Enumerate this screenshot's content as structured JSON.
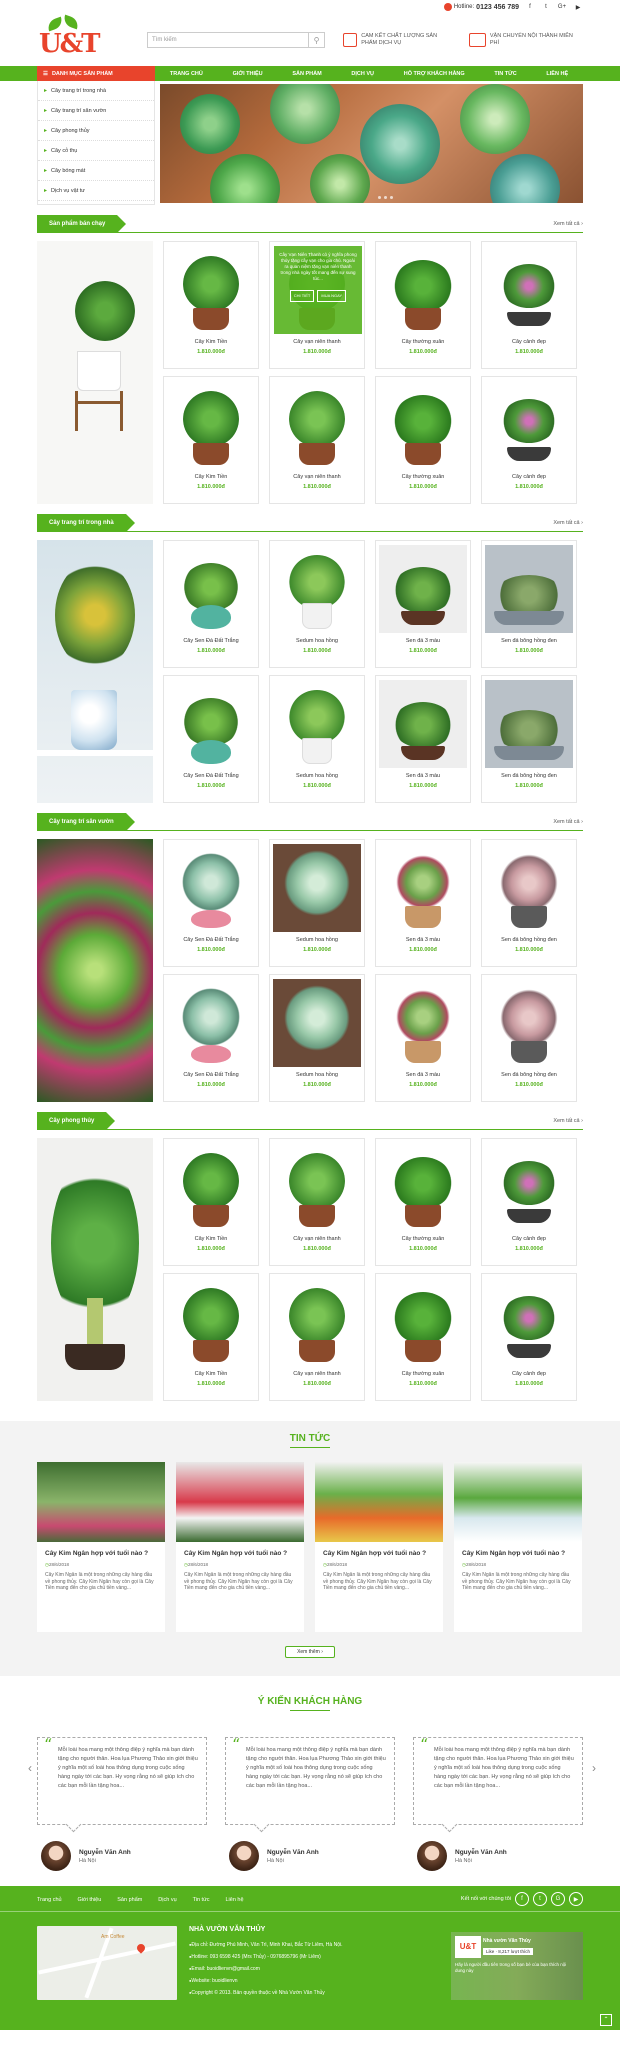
{
  "topbar": {
    "hotline_label": "Hotline:",
    "hotline_number": "0123 456 789",
    "social": [
      "f",
      "t",
      "G+",
      "▶"
    ]
  },
  "header": {
    "logo_text": "U&T",
    "search_placeholder": "Tìm kiếm",
    "promo1": "CAM KẾT CHẤT LƯỢNG SẢN PHẨM DỊCH VỤ",
    "promo2": "VẬN CHUYỂN NỘI THÀNH MIỄN PHÍ"
  },
  "nav": {
    "category_title": "DANH MỤC SẢN PHẨM",
    "items": [
      "TRANG CHỦ",
      "GIỚI THIỆU",
      "SẢN PHẨM",
      "DỊCH VỤ",
      "HỖ TRỢ KHÁCH HÀNG",
      "TIN TỨC",
      "LIÊN HỆ"
    ]
  },
  "sidebar": {
    "items": [
      "Cây trang trí trong nhà",
      "Cây trang trí sân vườn",
      "Cây phong thủy",
      "Cây cỏ thụ",
      "Cây bóng mát",
      "Dịch vụ vật tư"
    ]
  },
  "sections": [
    {
      "title": "Sản phẩm bán chạy",
      "more": "Xem tất cả",
      "products": [
        {
          "name": "Cây Kim Tiền",
          "price": "1.810.000đ"
        },
        {
          "name": "Cây vạn niên thanh",
          "price": "1.810.000đ"
        },
        {
          "name": "Cây thường xuân",
          "price": "1.810.000đ"
        },
        {
          "name": "Cây cảnh đẹp",
          "price": "1.810.000đ"
        },
        {
          "name": "Cây Kim Tiền",
          "price": "1.810.000đ"
        },
        {
          "name": "Cây vạn niên thanh",
          "price": "1.810.000đ"
        },
        {
          "name": "Cây thường xuân",
          "price": "1.810.000đ"
        },
        {
          "name": "Cây cảnh đẹp",
          "price": "1.810.000đ"
        }
      ],
      "hover_text": "Cây Vạn Niên Thanh cỏ ý nghĩa phong thủy tặng cây vạn cho gia chủ. Ngoài ra quan niệm tặng vạn niên thanh trong nhà ngày tốt mang đến sự sung túc...",
      "hover_btn1": "CHI TIẾT",
      "hover_btn2": "MUA NGAY"
    },
    {
      "title": "Cây trang trí trong nhà",
      "more": "Xem tất cả",
      "products": [
        {
          "name": "Cây Sen Đá Đất Trắng",
          "price": "1.810.000đ"
        },
        {
          "name": "Sedum hoa hồng",
          "price": "1.810.000đ"
        },
        {
          "name": "Sen đá 3 màu",
          "price": "1.810.000đ"
        },
        {
          "name": "Sen đá bông hồng đen",
          "price": "1.810.000đ"
        },
        {
          "name": "Cây Sen Đá Đất Trắng",
          "price": "1.810.000đ"
        },
        {
          "name": "Sedum hoa hồng",
          "price": "1.810.000đ"
        },
        {
          "name": "Sen đá 3 màu",
          "price": "1.810.000đ"
        },
        {
          "name": "Sen đá bông hồng đen",
          "price": "1.810.000đ"
        }
      ]
    },
    {
      "title": "Cây trang trí sân vườn",
      "more": "Xem tất cả",
      "products": [
        {
          "name": "Cây Sen Đá Đất Trắng",
          "price": "1.810.000đ"
        },
        {
          "name": "Sedum hoa hồng",
          "price": "1.810.000đ"
        },
        {
          "name": "Sen đá 3 màu",
          "price": "1.810.000đ"
        },
        {
          "name": "Sen đá bông hồng đen",
          "price": "1.810.000đ"
        },
        {
          "name": "Cây Sen Đá Đất Trắng",
          "price": "1.810.000đ"
        },
        {
          "name": "Sedum hoa hồng",
          "price": "1.810.000đ"
        },
        {
          "name": "Sen đá 3 màu",
          "price": "1.810.000đ"
        },
        {
          "name": "Sen đá bông hồng đen",
          "price": "1.810.000đ"
        }
      ]
    },
    {
      "title": "Cây phong thủy",
      "more": "Xem tất cả",
      "products": [
        {
          "name": "Cây Kim Tiền",
          "price": "1.810.000đ"
        },
        {
          "name": "Cây vạn niên thanh",
          "price": "1.810.000đ"
        },
        {
          "name": "Cây thường xuân",
          "price": "1.810.000đ"
        },
        {
          "name": "Cây cảnh đẹp",
          "price": "1.810.000đ"
        },
        {
          "name": "Cây Kim Tiền",
          "price": "1.810.000đ"
        },
        {
          "name": "Cây vạn niên thanh",
          "price": "1.810.000đ"
        },
        {
          "name": "Cây thường xuân",
          "price": "1.810.000đ"
        },
        {
          "name": "Cây cảnh đẹp",
          "price": "1.810.000đ"
        }
      ]
    }
  ],
  "news": {
    "title": "TIN TỨC",
    "more": "Xem thêm",
    "items": [
      {
        "title": "Cây Kim Ngân hợp với tuổi nào ?",
        "date": "28/6/2018",
        "excerpt": "Cây Kim Ngân là một trong những cây hàng đầu về phong thủy. Cây Kim Ngân hay còn gọi là Cây Tiền mang đến cho gia chủ tiền vàng..."
      },
      {
        "title": "Cây Kim Ngân hợp với tuổi nào ?",
        "date": "28/6/2018",
        "excerpt": "Cây Kim Ngân là một trong những cây hàng đầu về phong thủy. Cây Kim Ngân hay còn gọi là Cây Tiền mang đến cho gia chủ tiền vàng..."
      },
      {
        "title": "Cây Kim Ngân hợp với tuổi nào ?",
        "date": "28/6/2018",
        "excerpt": "Cây Kim Ngân là một trong những cây hàng đầu về phong thủy. Cây Kim Ngân hay còn gọi là Cây Tiền mang đến cho gia chủ tiền vàng..."
      },
      {
        "title": "Cây Kim Ngân hợp với tuổi nào ?",
        "date": "28/6/2018",
        "excerpt": "Cây Kim Ngân là một trong những cây hàng đầu về phong thủy. Cây Kim Ngân hay còn gọi là Cây Tiền mang đến cho gia chủ tiền vàng..."
      }
    ]
  },
  "testimonials": {
    "title": "Ý KIẾN KHÁCH HÀNG",
    "items": [
      {
        "text": "Mỗi loài hoa mang một thông điệp ý nghĩa mà bạn dành tặng cho người thân. Hoa lụa Phương Thảo xin giới thiệu ý nghĩa một số loài hoa thông dụng trong cuộc sống hàng ngày tới các bạn. Hy vọng rằng nó sẽ giúp ích cho các bạn mỗi lần tặng hoa...",
        "name": "Nguyễn Văn Anh",
        "city": "Hà Nội"
      },
      {
        "text": "Mỗi loài hoa mang một thông điệp ý nghĩa mà bạn dành tặng cho người thân. Hoa lụa Phương Thảo xin giới thiệu ý nghĩa một số loài hoa thông dụng trong cuộc sống hàng ngày tới các bạn. Hy vọng rằng nó sẽ giúp ích cho các bạn mỗi lần tặng hoa...",
        "name": "Nguyễn Văn Anh",
        "city": "Hà Nội"
      },
      {
        "text": "Mỗi loài hoa mang một thông điệp ý nghĩa mà bạn dành tặng cho người thân. Hoa lụa Phương Thảo xin giới thiệu ý nghĩa một số loài hoa thông dụng trong cuộc sống hàng ngày tới các bạn. Hy vọng rằng nó sẽ giúp ích cho các bạn mỗi lần tặng hoa...",
        "name": "Nguyễn Văn Anh",
        "city": "Hà Nội"
      }
    ]
  },
  "footer": {
    "links": [
      "Trang chủ",
      "Giới thiệu",
      "Sản phẩm",
      "Dịch vụ",
      "Tin tức",
      "Liên hệ"
    ],
    "connect": "Kết nối với chúng tôi",
    "company": "NHÀ VƯỜN VĂN THỦY",
    "address": "Địa chỉ: Đường Phú Minh, Văn Trì, Minh Khai, Bắc Từ Liêm, Hà Nội.",
    "hotline": "Hotline: 093 6598 425 (Mrs Thủy) - 0976895796 (Mr Liêm)",
    "email": "Email: buoidlienvn@gmail.com",
    "website": "Website: buoidlienvn",
    "copyright": "Copyright © 2013. Bản quyền thuộc về Nhà Vườn Văn Thủy",
    "map_label": "Am Coffee",
    "fb_name": "Nhà vườn Văn Thủy",
    "fb_like": "Like",
    "fb_likes": "8,217 lượt thích",
    "fb_text": "Hãy là người đầu tiên trong số bạn bè của bạn thích nội dung này"
  },
  "colors": {
    "brand_green": "#56b21e",
    "brand_red": "#e8442c"
  }
}
